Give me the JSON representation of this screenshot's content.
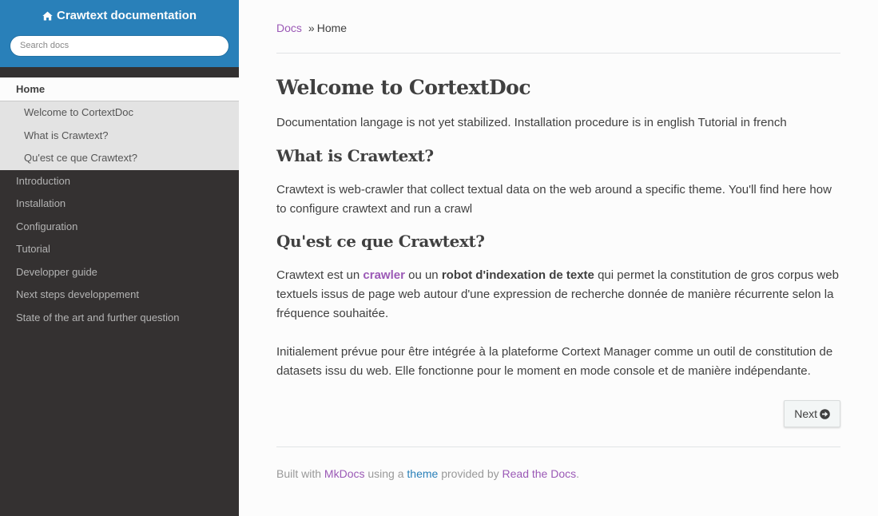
{
  "sidebar": {
    "site_title": "Crawtext documentation",
    "search_placeholder": "Search docs",
    "current": "Home",
    "sub_items": [
      "Welcome to CortextDoc",
      "What is Crawtext?",
      "Qu'est ce que Crawtext?"
    ],
    "items": [
      "Introduction",
      "Installation",
      "Configuration",
      "Tutorial",
      "Developper guide",
      "Next steps developpement",
      "State of the art and further question"
    ]
  },
  "breadcrumb": {
    "root": "Docs",
    "separator": "»",
    "current": "Home"
  },
  "main": {
    "title": "Welcome to CortextDoc",
    "intro": "Documentation langage is not yet stabilized. Installation procedure is in english Tutorial in french",
    "section1": {
      "heading": "What is Crawtext?",
      "text": "Crawtext is web-crawler that collect textual data on the web around a specific theme. You'll find here how to configure crawtext and run a crawl"
    },
    "section2": {
      "heading": "Qu'est ce que Crawtext?",
      "p1_before": "Crawtext est un ",
      "p1_link": "crawler",
      "p1_mid": " ou un ",
      "p1_bold": "robot d'indexation de texte",
      "p1_after": " qui permet la constitution de gros corpus web textuels issus de page web autour d'une expression de recherche donnée de manière récurrente selon la fréquence souhaitée.",
      "p2": "Initialement prévue pour être intégrée à la plateforme Cortext Manager comme un outil de constitution de datasets issu du web. Elle fonctionne pour le moment en mode console et de manière indépendante."
    },
    "next_label": "Next"
  },
  "footer": {
    "built_with": "Built with ",
    "mkdocs": "MkDocs",
    "using_a": " using a ",
    "theme": "theme",
    "provided_by": " provided by ",
    "rtd": "Read the Docs",
    "end": "."
  },
  "colors": {
    "header_blue": "#2980b9",
    "sidebar_dark": "#343131",
    "link_purple": "#9b59b6"
  },
  "icons": {
    "home": "home-icon",
    "next": "arrow-circle-right-icon"
  }
}
